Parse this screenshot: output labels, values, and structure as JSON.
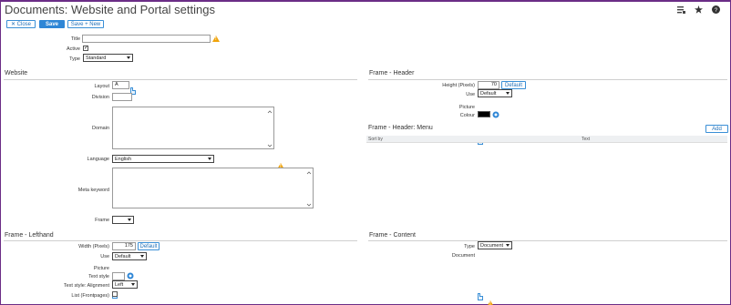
{
  "header": {
    "title": "Documents: Website and Portal settings",
    "icons": [
      "list-icon",
      "star-icon",
      "help-icon"
    ]
  },
  "toolbar": {
    "close": "✕ Close",
    "save": "Save",
    "save_new": "Save + New"
  },
  "general": {
    "title_label": "Title",
    "title_value": "",
    "active_label": "Active",
    "active_checked": "✓",
    "type_label": "Type",
    "type_value": "Standard"
  },
  "website": {
    "heading": "Website",
    "layout_label": "Layout",
    "layout_value": "A",
    "division_label": "Division",
    "division_value": "",
    "domain_label": "Domain",
    "language_label": "Language",
    "language_value": "English",
    "meta_label": "Meta keyword",
    "frame_label": "Frame",
    "frame_value": ""
  },
  "header_frame": {
    "heading": "Frame - Header",
    "height_label": "Height (Pixels)",
    "height_value": "70",
    "default_btn": "Default",
    "use_label": "Use",
    "use_value": "Default",
    "picture_label": "Picture",
    "colour_label": "Colour",
    "colour_value": "#000000"
  },
  "menu": {
    "heading": "Frame - Header: Menu",
    "add": "Add",
    "columns": [
      "Sort by",
      "Text"
    ]
  },
  "lefthand": {
    "heading": "Frame - Lefthand",
    "width_label": "Width (Pixels)",
    "width_value": "175",
    "default_btn": "Default",
    "use_label": "Use",
    "use_value": "Default",
    "picture_label": "Picture",
    "text_style_label": "Text style",
    "text_style_value": "",
    "align_label": "Text style: Alignment",
    "align_value": "Left",
    "list_label": "List (Frontpages)"
  },
  "content": {
    "heading": "Frame - Content",
    "type_label": "Type",
    "type_value": "Document",
    "document_label": "Document"
  },
  "warning_mark": "!"
}
